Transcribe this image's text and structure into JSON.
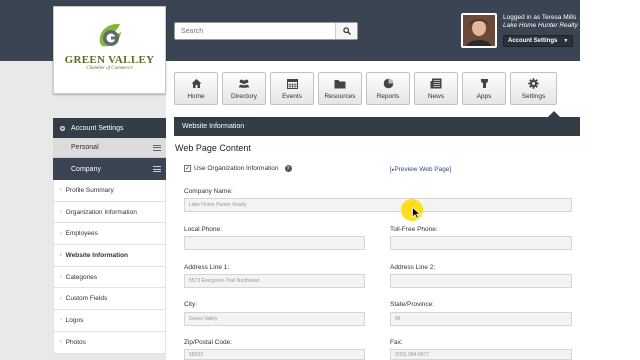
{
  "header": {
    "logo": {
      "name": "GREEN VALLEY",
      "subtitle": "Chamber of Commerce"
    },
    "search": {
      "placeholder": "Search"
    },
    "user": {
      "logged_in_text": "Logged in as Teresa Mills",
      "company": "Lake Home Hunter Realty",
      "account_button": "Account Settings"
    }
  },
  "nav": {
    "items": [
      {
        "label": "Home",
        "icon": "home-icon"
      },
      {
        "label": "Directory",
        "icon": "people-icon"
      },
      {
        "label": "Events",
        "icon": "calendar-icon"
      },
      {
        "label": "Resources",
        "icon": "folder-icon"
      },
      {
        "label": "Reports",
        "icon": "pie-chart-icon"
      },
      {
        "label": "News",
        "icon": "newspaper-icon"
      },
      {
        "label": "Apps",
        "icon": "apps-icon"
      },
      {
        "label": "Settings",
        "icon": "gear-icon"
      }
    ]
  },
  "sidebar": {
    "header": "Account Settings",
    "personal": "Personal",
    "company": "Company",
    "items": [
      {
        "label": "Profile Summary"
      },
      {
        "label": "Organization Information"
      },
      {
        "label": "Employees"
      },
      {
        "label": "Website Information",
        "active": true
      },
      {
        "label": "Categories"
      },
      {
        "label": "Custom Fields"
      },
      {
        "label": "Logos"
      },
      {
        "label": "Photos"
      }
    ]
  },
  "main": {
    "section_title": "Website Information",
    "page_title": "Web Page Content",
    "use_org_info": "Use Organization Information",
    "preview_link": "Preview Web Page",
    "fields": {
      "company_name": {
        "label": "Company Name:",
        "value": "Lake Home Hunter Realty"
      },
      "local_phone": {
        "label": "Local Phone:",
        "value": ""
      },
      "toll_free": {
        "label": "Toll-Free Phone:",
        "value": ""
      },
      "address1": {
        "label": "Address Line 1:",
        "value": "5573 Evergreen Trail Northwest"
      },
      "address2": {
        "label": "Address Line 2:",
        "value": ""
      },
      "city": {
        "label": "City:",
        "value": "Green Valley"
      },
      "state": {
        "label": "State/Province:",
        "value": "MI"
      },
      "zip": {
        "label": "Zip/Postal Code:",
        "value": "58033"
      },
      "fax": {
        "label": "Fax:",
        "value": "(555) 984-0677"
      }
    }
  },
  "colors": {
    "dark_bar": "#333d48",
    "header": "#3a4452",
    "brand_green": "#5a6e2a",
    "link": "#2a4f8a",
    "cursor_highlight": "#ffdc00"
  }
}
